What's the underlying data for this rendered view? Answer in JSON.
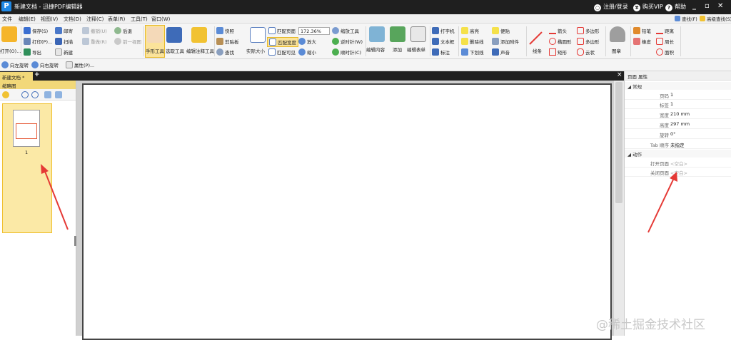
{
  "app": {
    "title": "新建文档 - 迅捷PDF编辑器",
    "logo": "P",
    "login": "注册/登录",
    "vip": "购买VIP",
    "help": "帮助"
  },
  "menu": [
    "文件",
    "编辑(E)",
    "视图(V)",
    "文档(D)",
    "注释(C)",
    "表单(R)",
    "工具(T)",
    "窗口(W)"
  ],
  "ribbon": {
    "open": "打开(O)...",
    "save": "保存(S)",
    "print": "打印(P)...",
    "import": "导出",
    "email": "邮寄",
    "scan": "扫描",
    "new": "新建",
    "undo": "撤销(U)",
    "redo": "重做(R)",
    "back": "后退",
    "prev_view": "前一视图",
    "hand": "手形工具",
    "select": "选取工具",
    "annot_tool": "编辑注释工具",
    "snapshot": "快照",
    "clipboard": "剪贴板",
    "find": "查找",
    "actual_size": "实际大小",
    "fit_page": "匹配页面",
    "fit_width": "匹配宽度",
    "fit_visible": "匹配可见",
    "zoom_value": "172.36%",
    "zoom_in": "放大",
    "zoom_out": "缩小",
    "zoom_tool": "缩放工具",
    "rotate_ccw": "逆时针(W)",
    "rotate_cw": "顺时针(C)",
    "edit_content": "编辑内容",
    "add": "添加",
    "edit_form": "编辑表单",
    "typewriter": "打字机",
    "textbox": "文本框",
    "callout": "标注",
    "highlight": "高亮",
    "strikeout": "删除线",
    "underline": "下划线",
    "note": "便贴",
    "attach": "添加附件",
    "sound": "声音",
    "line": "线条",
    "arrow": "箭头",
    "ellipse": "椭圆形",
    "rect": "矩形",
    "polygon": "多边形",
    "polyline": "多边形",
    "cloud": "云状",
    "stamp": "图章",
    "pencil": "铅笔",
    "eraser": "橡皮",
    "distance": "距离",
    "perimeter": "周长",
    "area": "面积",
    "search_f": "查找(F)",
    "adv_search": "高级查找(S)"
  },
  "quickbar": {
    "rotate_left": "向左旋转",
    "rotate_right": "向右旋转",
    "properties": "属性(P)..."
  },
  "tabs": {
    "doc_tab": "新建文档 *",
    "close": "×",
    "add": "+"
  },
  "left_panel": {
    "title": "缩略图",
    "page_label": "1"
  },
  "right_panel": {
    "title": "页面 属性",
    "sections": {
      "general": "常规",
      "actions": "动作"
    },
    "props": [
      {
        "key": "页码",
        "value": "1"
      },
      {
        "key": "标签",
        "value": "1"
      },
      {
        "key": "宽度",
        "value": "210 mm"
      },
      {
        "key": "高度",
        "value": "297 mm"
      },
      {
        "key": "旋转",
        "value": "0°"
      },
      {
        "key": "Tab 顺序",
        "value": "未指定"
      }
    ],
    "actions": [
      {
        "key": "打开页面",
        "value": "<空白>"
      },
      {
        "key": "关闭页面",
        "value": "<空白>"
      }
    ]
  },
  "watermark": "@稀土掘金技术社区",
  "colors": {
    "title_bg": "#1f1f1f",
    "accent_yellow": "#f2d879",
    "arrow_red": "#e53935"
  }
}
